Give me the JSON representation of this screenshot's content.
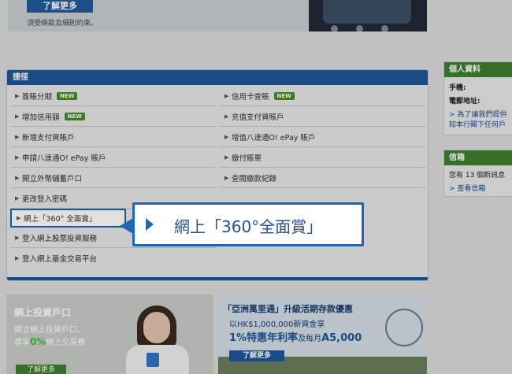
{
  "banner": {
    "learn_more": "了解更多",
    "terms_note": "須受條款及細則約束。"
  },
  "quick_links": {
    "title": "捷徑",
    "new_badge": "NEW",
    "left": [
      {
        "label": "簽賬分期",
        "new": true
      },
      {
        "label": "增加信用額",
        "new": true
      },
      {
        "label": "新增支付資賬戶",
        "new": false
      },
      {
        "label": "申請八達通O! ePay 賬戶",
        "new": false
      },
      {
        "label": "開立外幣儲蓄戶口",
        "new": false
      },
      {
        "label": "更改登入密碼",
        "new": false
      },
      {
        "label": "網上「360° 全面賞」",
        "new": false
      },
      {
        "label": "登入網上股票投資服務",
        "new": false
      },
      {
        "label": "登入網上基金交易平台",
        "new": false
      }
    ],
    "right": [
      {
        "label": "信用卡查賬",
        "new": true
      },
      {
        "label": "充值支付資賬戶",
        "new": false
      },
      {
        "label": "增值八達通O! ePay 賬戶",
        "new": false
      },
      {
        "label": "繳付賬單",
        "new": false
      },
      {
        "label": "查閱繳款紀錄",
        "new": false
      }
    ]
  },
  "callout": {
    "text": "網上「360°全面賞」"
  },
  "personal": {
    "title": "個人資料",
    "phone_label": "手機:",
    "address_label": "電郵地址:",
    "link_line1": "> 為了讓我們提供",
    "link_line2": "知本行閣下任何戶"
  },
  "inbox": {
    "title": "信箱",
    "count_text": "您有 13 個新訊息",
    "view_link": "> 查看信箱"
  },
  "promo_invest": {
    "title": "網上投資戶口",
    "line1": "開立網上投資戶口，",
    "line2_pre": "尊享",
    "line2_highlight": "0%",
    "line2_post": "網上交易費",
    "button": "了解更多"
  },
  "promo_deposit": {
    "title": "「亞洲萬里通」升級活期存款優惠",
    "line1": "以HK$1,000,000新資金享",
    "line2_a": "1%特惠年利率",
    "line2_b": "及每月",
    "line2_c": "A5,000",
    "button": "了解更多"
  }
}
